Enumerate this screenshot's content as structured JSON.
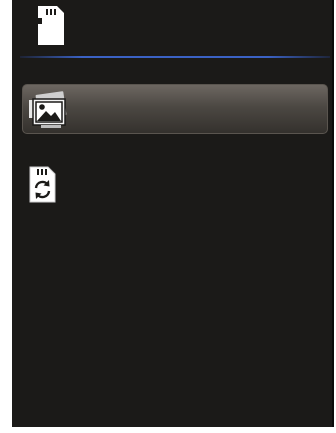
{
  "header": {
    "icon": "sd-card-icon"
  },
  "menu": {
    "items": [
      {
        "icon": "gallery-image-icon",
        "label": "",
        "selected": true
      },
      {
        "icon": "sd-card-sync-icon",
        "label": "",
        "selected": false
      }
    ]
  },
  "colors": {
    "background": "#1b1a18",
    "divider": "#3b62c4",
    "selection": "#4c4843"
  }
}
